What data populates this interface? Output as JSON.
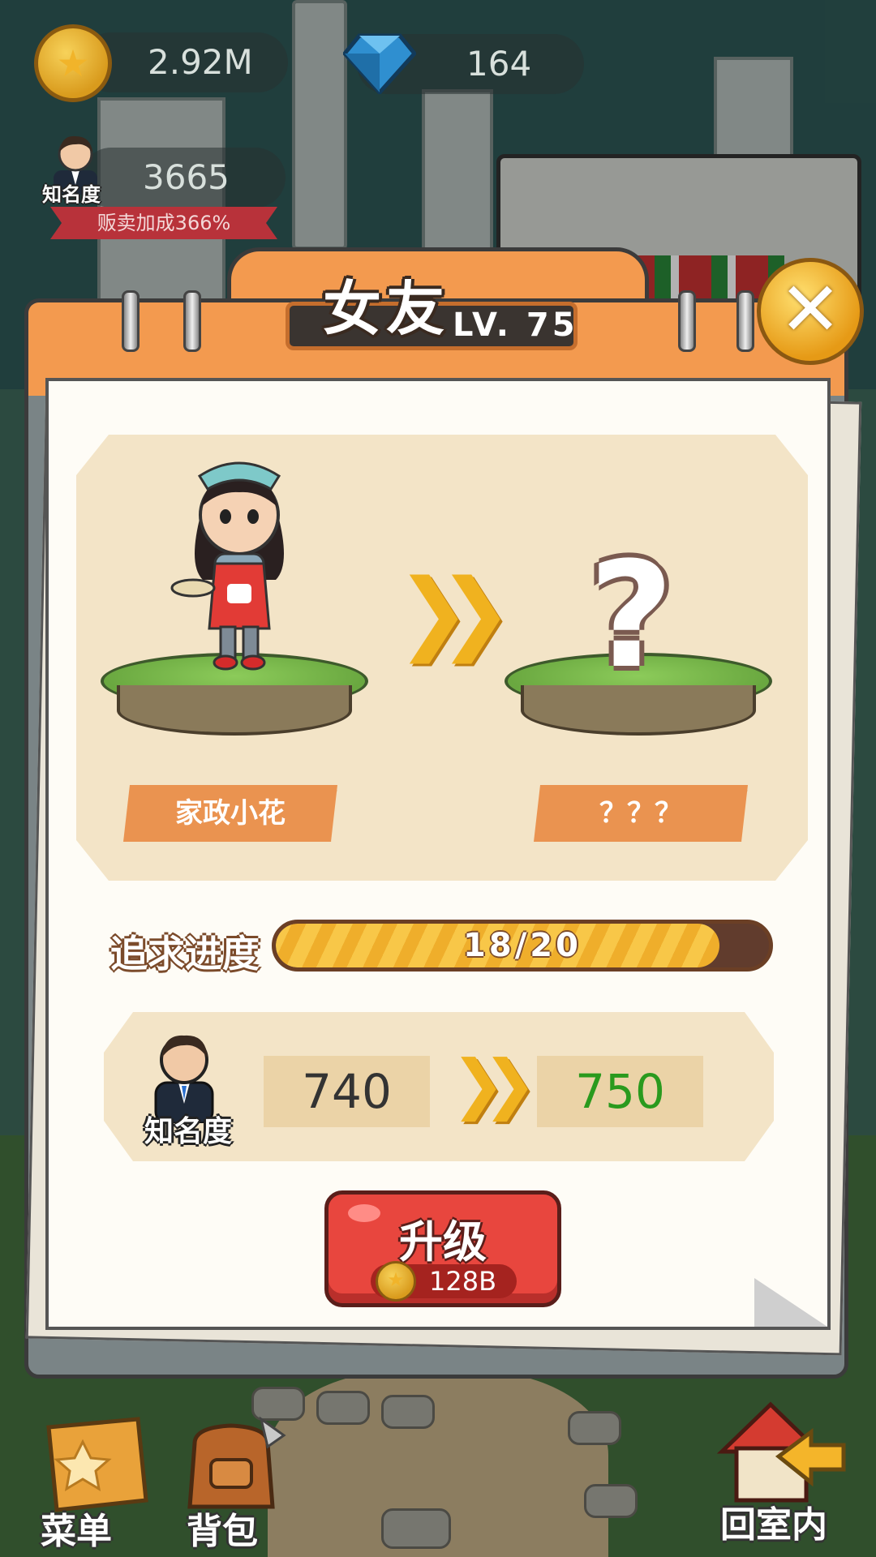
{
  "hud": {
    "coins": "2.92M",
    "gems": "164",
    "fame_value": "3665",
    "fame_label": "知名度",
    "sales_bonus": "贩卖加成366%"
  },
  "dialog": {
    "title": "女友",
    "level": "LV. 75",
    "current_partner_name": "家政小花",
    "next_partner_name": "？？？",
    "next_partner_mark": "?",
    "progress_label": "追求进度",
    "progress_text": "18/20",
    "progress_fraction": 0.9,
    "fame_label": "知名度",
    "fame_current": "740",
    "fame_next": "750",
    "upgrade_label": "升级",
    "upgrade_cost": "128B"
  },
  "nav": {
    "menu": "菜单",
    "bag": "背包",
    "back_home": "回室内"
  },
  "colors": {
    "fame_next": "#2a9a1e",
    "fame_current": "#333333",
    "accent_orange": "#f39a4f",
    "button_red": "#e8463e"
  },
  "icons": [
    "coin-icon",
    "gem-icon",
    "close-icon",
    "chevron-right-icon",
    "businessman-avatar-icon",
    "question-mark-icon",
    "menu-book-icon",
    "backpack-icon",
    "home-arrow-icon"
  ]
}
